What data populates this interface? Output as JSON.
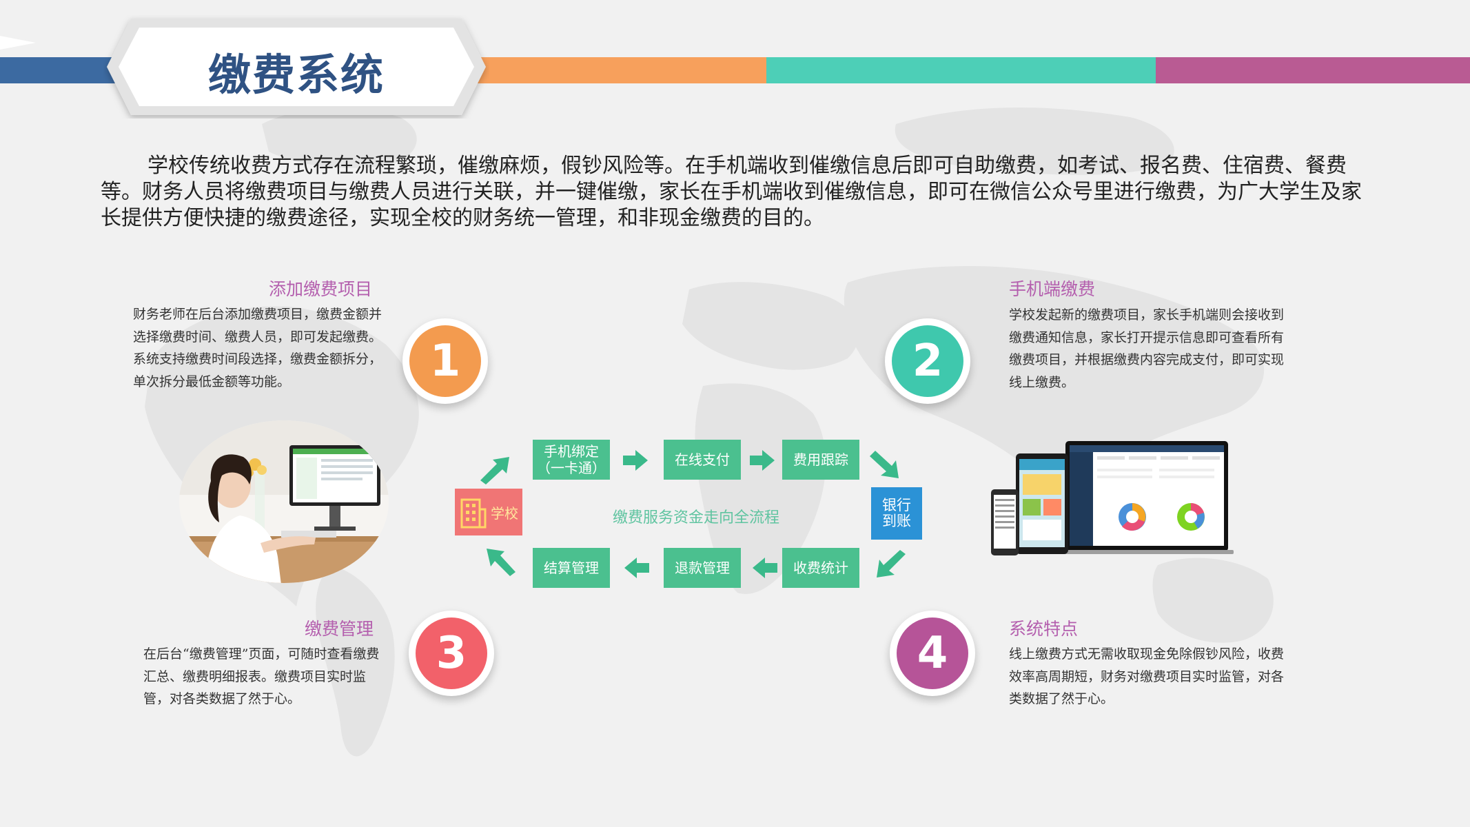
{
  "title": "缴费系统",
  "intro": "学校传统收费方式存在流程繁琐，催缴麻烦，假钞风险等。在手机端收到催缴信息后即可自助缴费，如考试、报名费、住宿费、餐费等。财务人员将缴费项目与缴费人员进行关联，并一键催缴，家长在手机端收到催缴信息，即可在微信公众号里进行缴费，为广大学生及家长提供方便快捷的缴费途径，实现全校的财务统一管理，和非现金缴费的目的。",
  "sections": [
    {
      "number": "1",
      "title": "添加缴费项目",
      "body": "财务老师在后台添加缴费项目，缴费金额并选择缴费时间、缴费人员，即可发起缴费。系统支持缴费时间段选择，缴费金额拆分，单次拆分最低金额等功能。",
      "color": "#f39b4f"
    },
    {
      "number": "2",
      "title": "手机端缴费",
      "body": "学校发起新的缴费项目，家长手机端则会接收到缴费通知信息，家长打开提示信息即可查看所有缴费项目，并根据缴费内容完成支付，即可实现线上缴费。",
      "color": "#3fc8ad"
    },
    {
      "number": "3",
      "title": "缴费管理",
      "body": "在后台“缴费管理”页面，可随时查看缴费汇总、缴费明细报表。缴费项目实时监管，对各类数据了然于心。",
      "color": "#f2616a"
    },
    {
      "number": "4",
      "title": "系统特点",
      "body": "线上缴费方式无需收取现金免除假钞风险，收费效率高周期短，财务对缴费项目实时监管，对各类数据了然于心。",
      "color": "#b65498"
    }
  ],
  "flow": {
    "center_label": "缴费服务资金走向全流程",
    "school": "学校",
    "bank": "银行到账",
    "top_steps": [
      "手机绑定\n（一卡通）",
      "在线支付",
      "费用跟踪"
    ],
    "bottom_steps": [
      "结算管理",
      "退款管理",
      "收费统计"
    ]
  },
  "colors": {
    "title_text": "#2f5283",
    "section_title": "#b45fae",
    "flow_box": "#4bc08f",
    "school_box": "#f07575",
    "bank_box": "#2b92d6"
  }
}
